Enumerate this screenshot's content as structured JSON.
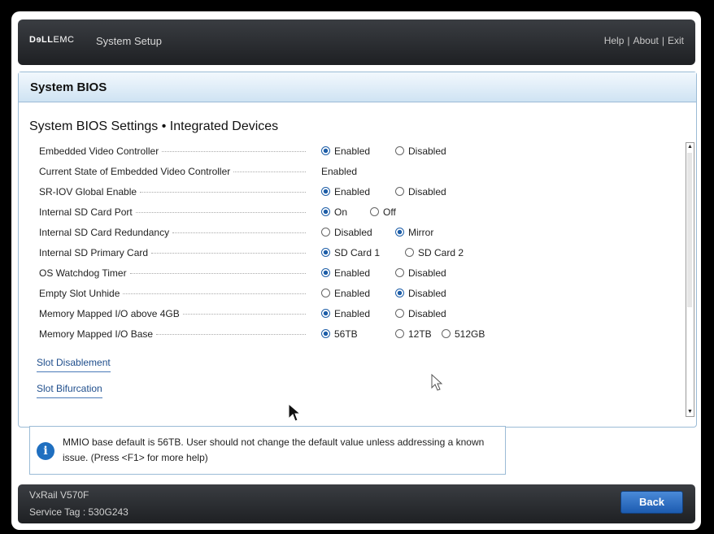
{
  "header": {
    "logo_bold": "DɘLL",
    "logo_rest": "EMC",
    "title": "System Setup",
    "links": [
      "Help",
      "About",
      "Exit"
    ],
    "separator": "|"
  },
  "panel": {
    "title": "System BIOS",
    "subtitle": "System BIOS Settings • Integrated Devices"
  },
  "settings": [
    {
      "label": "Embedded Video Controller",
      "options": [
        "Enabled",
        "Disabled"
      ],
      "selected": 0
    },
    {
      "label": "Current State of Embedded Video Controller",
      "value": "Enabled"
    },
    {
      "label": "SR-IOV Global Enable",
      "options": [
        "Enabled",
        "Disabled"
      ],
      "selected": 0
    },
    {
      "label": "Internal SD Card Port",
      "options": [
        "On",
        "Off"
      ],
      "selected": 0
    },
    {
      "label": "Internal SD Card Redundancy",
      "options": [
        "Disabled",
        "Mirror"
      ],
      "selected": 1
    },
    {
      "label": "Internal SD Primary Card",
      "options": [
        "SD Card 1",
        "SD Card 2"
      ],
      "selected": 0
    },
    {
      "label": "OS Watchdog Timer",
      "options": [
        "Enabled",
        "Disabled"
      ],
      "selected": 0
    },
    {
      "label": "Empty Slot Unhide",
      "options": [
        "Enabled",
        "Disabled"
      ],
      "selected": 1
    },
    {
      "label": "Memory Mapped I/O above 4GB",
      "options": [
        "Enabled",
        "Disabled"
      ],
      "selected": 0
    },
    {
      "label": "Memory Mapped I/O Base",
      "options": [
        "56TB",
        "12TB",
        "512GB"
      ],
      "selected": 0
    }
  ],
  "links": {
    "slot_disablement": "Slot Disablement",
    "slot_bifurcation": "Slot Bifurcation"
  },
  "help": {
    "icon": "info-icon",
    "text": "MMIO base default is 56TB. User should not change the default value unless addressing a known issue. (Press <F1> for more help)"
  },
  "footer": {
    "model": "VxRail V570F",
    "service_tag": "Service Tag : 530G243",
    "back_label": "Back"
  },
  "colors": {
    "accent": "#1f5fa8",
    "header_bg": "#2b2e33",
    "panel_border": "#9bbbd6"
  }
}
